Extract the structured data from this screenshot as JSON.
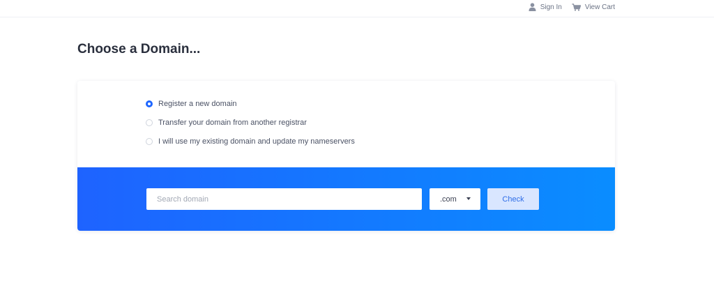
{
  "header": {
    "sign_in": "Sign In",
    "view_cart": "View Cart",
    "sign_in_icon": "user-icon",
    "cart_icon": "cart-icon"
  },
  "page": {
    "title": "Choose a Domain..."
  },
  "options": [
    {
      "label": "Register a new domain",
      "checked": true
    },
    {
      "label": "Transfer your domain from another registrar",
      "checked": false
    },
    {
      "label": "I will use my existing domain and update my nameservers",
      "checked": false
    }
  ],
  "search": {
    "placeholder": "Search domain",
    "value": "",
    "tld": ".com",
    "check_label": "Check"
  },
  "colors": {
    "accent": "#1e66ff",
    "band_start": "#1e63ff",
    "band_end": "#0a8dff",
    "check_bg": "#d9e6ff"
  }
}
